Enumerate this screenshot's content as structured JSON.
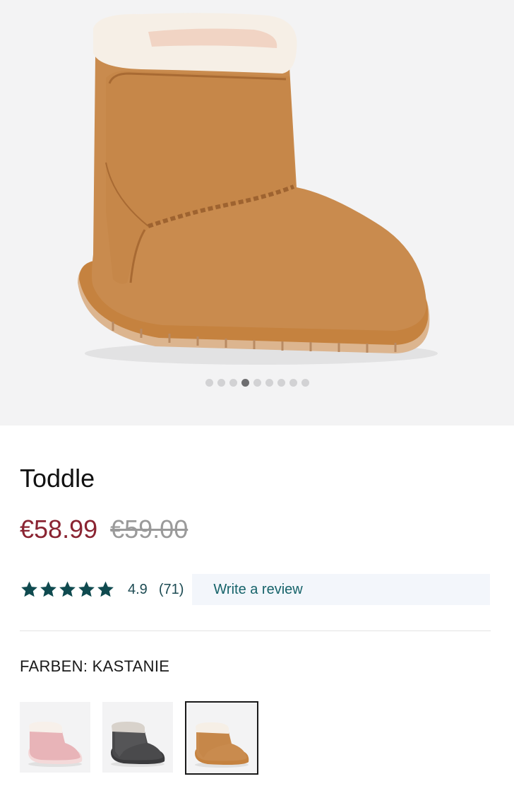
{
  "product": {
    "title": "Toddle",
    "price_sale": "€58.99",
    "price_original": "€59.00",
    "rating_value": "4.9",
    "rating_count": "(71)",
    "rating_stars": 5,
    "write_review_label": "Write a review",
    "color_label": "FARBEN: KASTANIE"
  },
  "gallery": {
    "image_count": 9,
    "active_index": 3
  },
  "colors": {
    "sale_price": "#8a2432",
    "star": "#0f4a4f",
    "link": "#16636a",
    "chestnut": "#c98b4e"
  },
  "swatches": [
    {
      "name": "pink",
      "color": "#e8b4b8",
      "selected": false
    },
    {
      "name": "charcoal",
      "color": "#4a4a4c",
      "selected": false
    },
    {
      "name": "chestnut",
      "color": "#c58a4c",
      "selected": true
    }
  ]
}
